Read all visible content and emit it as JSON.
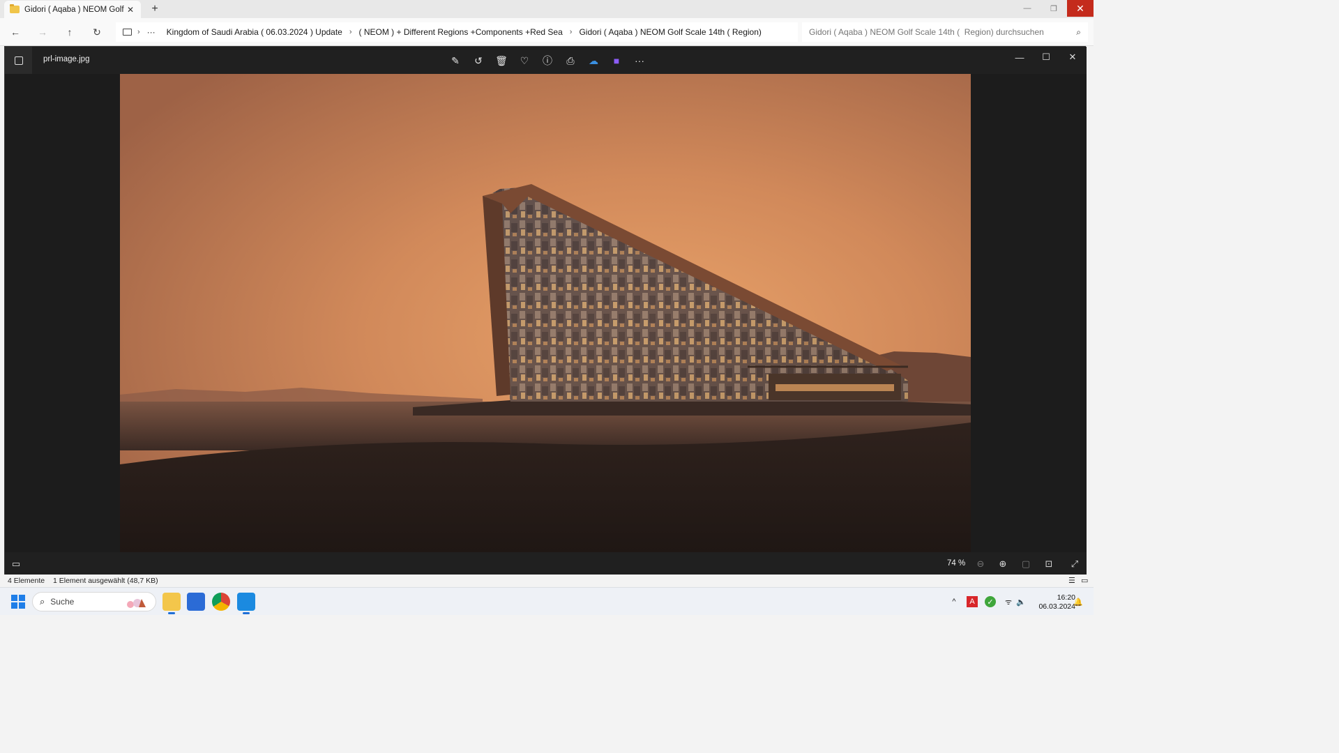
{
  "window": {
    "tab_title": "Gidori ( Aqaba ) NEOM Golf Sc",
    "new_tab_symbol": "+"
  },
  "address": {
    "breadcrumbs": [
      "Kingdom of Saudi Arabia ( 06.03.2024 ) Update",
      "( NEOM ) + Different Regions +Components +Red Sea",
      "Gidori ( Aqaba ) NEOM Golf Scale 14th (  Region)"
    ],
    "search_placeholder": "Gidori ( Aqaba ) NEOM Golf Scale 14th (  Region) durchsuchen",
    "overflow": "···"
  },
  "viewer": {
    "file_name": "prl-image.jpg",
    "zoom_level": "74 %"
  },
  "status": {
    "item_count": "4 Elemente",
    "selection": "1 Element ausgewählt (48,7 KB)"
  },
  "taskbar": {
    "search_label": "Suche",
    "time": "16:20",
    "date": "06.03.2024"
  },
  "colors": {
    "close_red": "#c42b1c",
    "viewer_bg": "#1e1e1e",
    "accent_blue": "#1f7ee8"
  }
}
